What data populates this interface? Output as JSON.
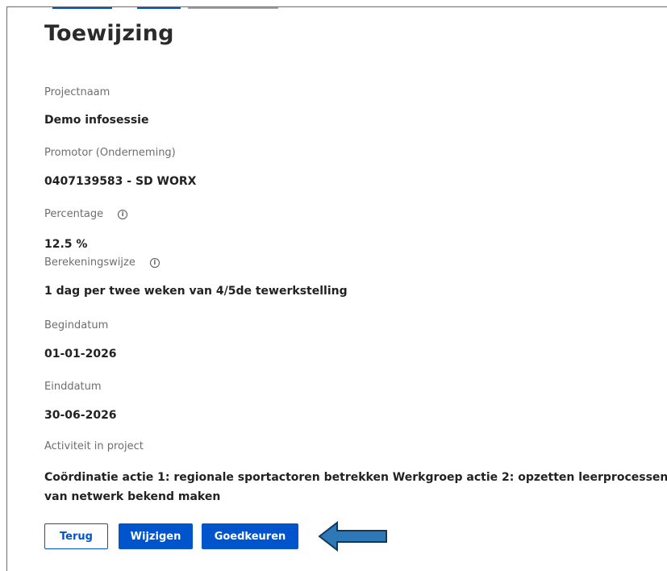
{
  "title": "Toewijzing",
  "fields": {
    "project_name": {
      "label": "Projectnaam",
      "value": "Demo infosessie"
    },
    "promotor": {
      "label": "Promotor (Onderneming)",
      "value": "0407139583 - SD WORX"
    },
    "percentage": {
      "label": "Percentage",
      "value": "12.5 %",
      "info_icon": "info-icon"
    },
    "calculation": {
      "label": "Berekeningswijze",
      "value": "1 dag per twee weken van 4/5de tewerkstelling",
      "info_icon": "info-icon"
    },
    "start_date": {
      "label": "Begindatum",
      "value": "01-01-2026"
    },
    "end_date": {
      "label": "Einddatum",
      "value": "30-06-2026"
    },
    "activity": {
      "label": "Activiteit in project",
      "value": "Coördinatie actie 1: regionale sportactoren betrekken Werkgroep actie 2: opzetten leerprocessen van netwerk bekend maken"
    }
  },
  "buttons": {
    "back": "Terug",
    "edit": "Wijzigen",
    "approve": "Goedkeuren"
  },
  "colors": {
    "primary": "#0055cc",
    "arrow_fill": "#2e78b8",
    "arrow_stroke": "#12375e"
  }
}
